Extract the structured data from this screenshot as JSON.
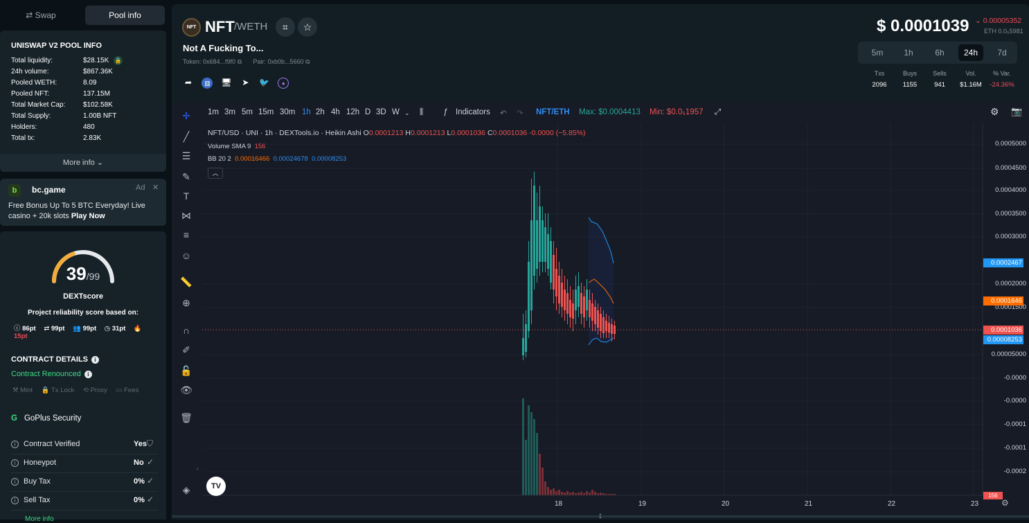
{
  "sidebar": {
    "tabs": {
      "swap": "⇄  Swap",
      "pool": "Pool info"
    },
    "pool": {
      "title": "UNISWAP V2 POOL INFO",
      "rows": [
        {
          "k": "Total liquidity:",
          "v": "$28.15K"
        },
        {
          "k": "24h volume:",
          "v": "$867.36K"
        },
        {
          "k": "Pooled WETH:",
          "v": "8.09"
        },
        {
          "k": "Pooled NFT:",
          "v": "137.15M"
        },
        {
          "k": "Total Market Cap:",
          "v": "$102.58K"
        },
        {
          "k": "Total Supply:",
          "v": "1.00B NFT"
        },
        {
          "k": "Holders:",
          "v": "480"
        },
        {
          "k": "Total tx:",
          "v": "2.83K"
        }
      ],
      "more": "More info ⌄"
    },
    "ad": {
      "name": "bc.game",
      "tag": "Ad",
      "close": "✕",
      "text": "Free Bonus Up To 5 BTC Everyday! Live casino + 20k slots ",
      "cta": "Play Now"
    },
    "score": {
      "value": "39",
      "max": "/99",
      "value_fraction": 0.39,
      "label": "DEXTscore",
      "sub": "Project reliability score based on:",
      "points": [
        "86pt",
        "99pt",
        "99pt",
        "31pt",
        "15pt"
      ],
      "contract_title": "CONTRACT DETAILS",
      "renounced": "Contract Renounced",
      "flags": [
        "Mint",
        "Tx Lock",
        "Proxy",
        "Fees"
      ],
      "goplus": "GoPlus Security",
      "security": [
        {
          "k": "Contract Verified",
          "v": "Yes"
        },
        {
          "k": "Honeypot",
          "v": "No"
        },
        {
          "k": "Buy Tax",
          "v": "0%"
        },
        {
          "k": "Sell Tax",
          "v": "0%"
        }
      ],
      "more": "More info"
    }
  },
  "header": {
    "symbol": "NFT",
    "pair": "/WETH",
    "icon_text": "NFT",
    "name": "Not A Fucking To...",
    "token": "Token: 0x684...f9f0",
    "pairaddr": "Pair: 0xb0b...5660",
    "price": "$ 0.0001039",
    "change": "⌄ 0.00005352",
    "eth": "ETH 0.0₅5981",
    "timeframes": [
      "5m",
      "1h",
      "6h",
      "24h",
      "7d"
    ],
    "active_tf": "24h",
    "stats": [
      {
        "h": "Txs",
        "n": "2096"
      },
      {
        "h": "Buys",
        "n": "1155"
      },
      {
        "h": "Sells",
        "n": "941"
      },
      {
        "h": "Vol.",
        "n": "$1.16M"
      },
      {
        "h": "% Var.",
        "n": "-24.36%"
      }
    ]
  },
  "chart": {
    "intervals": [
      "1m",
      "3m",
      "5m",
      "15m",
      "30m",
      "1h",
      "2h",
      "4h",
      "12h",
      "D",
      "3D",
      "W"
    ],
    "active_interval": "1h",
    "indicators": "Indicators",
    "pair": "NFT/ETH",
    "max": "Max: $0.0004413",
    "min": "Min: $0.0₅1957",
    "legend_title": "NFT/USD · UNI · 1h · DEXTools.io · Heikin Ashi",
    "ohlc": {
      "o": "0.0001213",
      "h": "0.0001213",
      "l": "0.0001036",
      "c": "0.0001036",
      "chg": "-0.0000 (−5.85%)"
    },
    "vol_label": "Volume SMA 9",
    "vol_val": "156",
    "bb_label": "BB 20 2",
    "bb_vals": [
      "0.00016466",
      "0.00024678",
      "0.00008253"
    ],
    "y_labels": [
      "0.0005000",
      "0.0004500",
      "0.0004000",
      "0.0003500",
      "0.0003000",
      "0.0002000",
      "0.0001500",
      "0.00005000",
      "-0.0000",
      "-0.0000",
      "-0.0001",
      "-0.0001",
      "-0.0002"
    ],
    "y_tags": [
      {
        "v": "0.0002467",
        "c": "#2196f3"
      },
      {
        "v": "0.0001646",
        "c": "#ff6d00"
      },
      {
        "v": "0.0001036",
        "c": "#ef5350"
      },
      {
        "v": "0.00008253",
        "c": "#2196f3"
      }
    ],
    "vol_tag": "156",
    "x_labels": [
      "18",
      "19",
      "20",
      "21",
      "22",
      "23"
    ],
    "colors": {
      "up": "#26a69a",
      "down": "#ef5350"
    }
  }
}
